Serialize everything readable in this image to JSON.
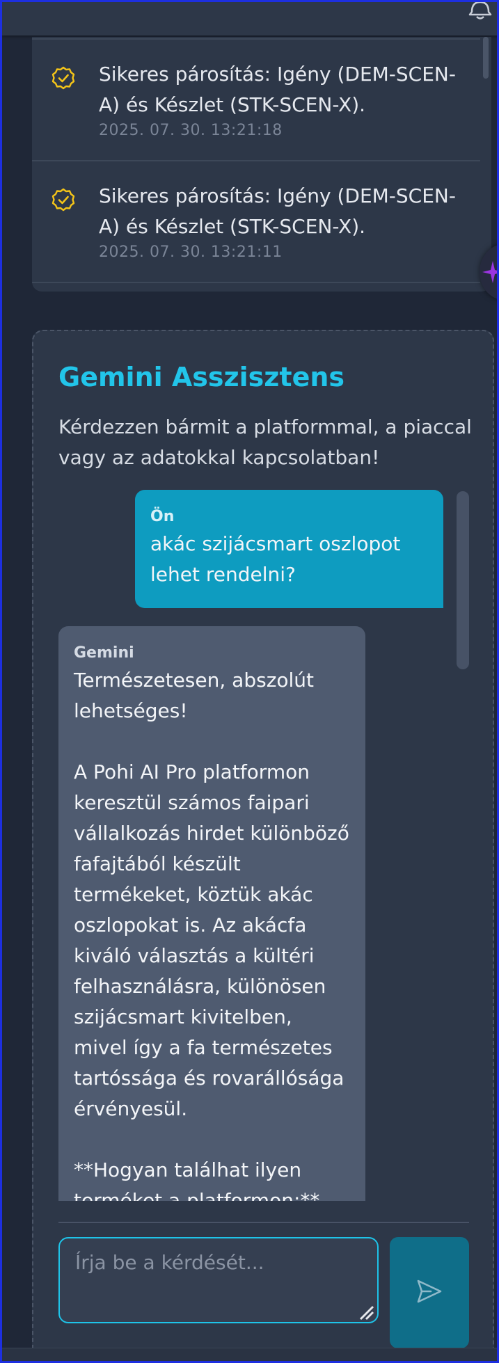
{
  "colors": {
    "accent": "#22c5ea",
    "user_bubble": "#0e9cc0",
    "assistant_bubble": "#4f5b70",
    "success_icon": "#f5c518",
    "send_button": "#0f6e89"
  },
  "header": {
    "icon": "bell-icon"
  },
  "activity": {
    "items": [
      {
        "icon": "check-circle-icon",
        "text": "Sikeres párosítás: Igény (DEM-SCEN-A) és Készlet (STK-SCEN-X).",
        "time": "2025. 07. 30. 13:21:18"
      },
      {
        "icon": "check-circle-icon",
        "text": "Sikeres párosítás: Igény (DEM-SCEN-A) és Készlet (STK-SCEN-X).",
        "time": "2025. 07. 30. 13:21:11"
      }
    ]
  },
  "assistant": {
    "title": "Gemini Asszisztens",
    "subtitle": "Kérdezzen bármit a platformmal, a piaccal vagy az adatokkal kapcsolatban!",
    "messages": [
      {
        "sender": "Ön",
        "text": "akác szijácsmart oszlopot lehet rendelni?"
      },
      {
        "sender": "Gemini",
        "text": "Természetesen, abszolút lehetséges!\n\nA Pohi AI Pro platformon keresztül számos faipari vállalkozás hirdet különböző fafajtából készült termékeket, köztük akác oszlopokat is. Az akácfa kiváló választás a kültéri felhasználásra, különösen szijácsmart kivitelben, mivel így a fa természetes tartóssága és rovarállósága érvényesül.\n\n**Hogyan találhat ilyen terméket a platformon:**"
      }
    ],
    "input": {
      "value": "",
      "placeholder": "Írja be a kérdését..."
    },
    "send_icon": "send-icon"
  }
}
